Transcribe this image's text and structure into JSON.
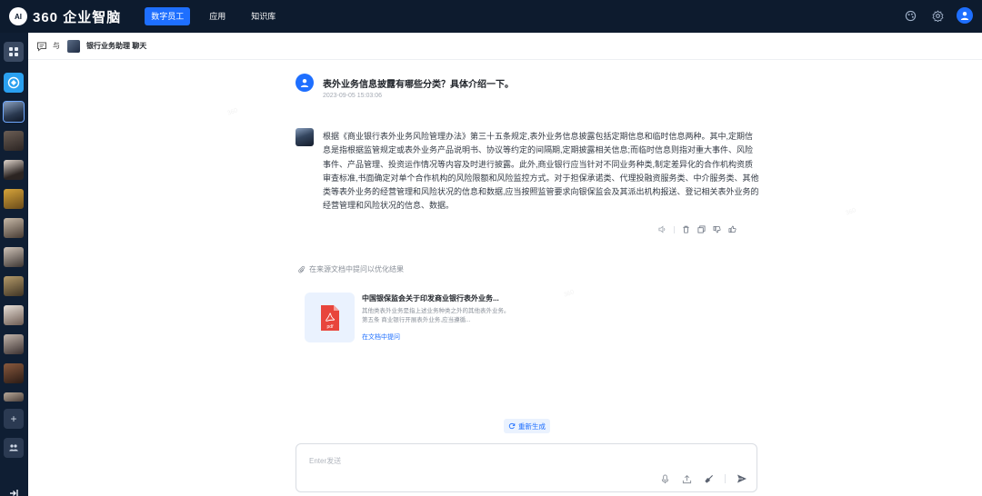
{
  "topbar": {
    "logo_badge": "AI",
    "logo_text": "360 企业智脑",
    "nav": [
      "数字员工",
      "应用",
      "知识库"
    ],
    "icons": [
      "palette-icon",
      "gear-icon",
      "user-avatar-icon"
    ]
  },
  "chat_header": {
    "with_label": "与",
    "title": "银行业务助理 聊天"
  },
  "question": {
    "text": "表外业务信息披露有哪些分类？具体介绍一下。",
    "time": "2023-09-05 15:03:06"
  },
  "answer": {
    "text": "根据《商业银行表外业务风险管理办法》第三十五条规定,表外业务信息披露包括定期信息和临时信息两种。其中,定期信息是指根据监管规定或表外业务产品说明书、协议等约定的间隔期,定期披露相关信息;而临时信息则指对重大事件、风险事件、产品管理、投资运作情况等内容及时进行披露。此外,商业银行应当针对不同业务种类,制定差异化的合作机构资质审查标准,书面确定对单个合作机构的风险限额和风险监控方式。对于担保承诺类、代理投融资服务类、中介服务类、其他类等表外业务的经营管理和风险状况的信息和数据,应当按照监管要求向银保监会及其派出机构报送、登记相关表外业务的经营管理和风险状况的信息、数据。"
  },
  "source": {
    "tip": "在来源文档中提问以优化结果",
    "doc_title": "中国银保监会关于印发商业银行表外业务...",
    "snippet": "其他类表外业务是指上述业务种类之外的其他表外业务。 第五条 商业银行开展表外业务,应当遵循...",
    "file_type": "pdf",
    "link": "在文档中提问"
  },
  "regenerate_label": "重新生成",
  "input": {
    "placeholder": "Enter发送"
  },
  "colors": {
    "brand": "#1e6fff",
    "topbar_bg": "#0d1b2e",
    "rail_bg": "#0f1e33",
    "pdf_red": "#e8453c"
  }
}
